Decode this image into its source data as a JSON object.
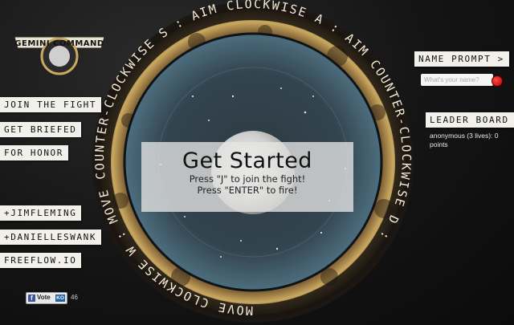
{
  "logo": {
    "text": "GEMINI COMMAND"
  },
  "left_menu": {
    "join": "JOIN THE FIGHT",
    "brief": "GET BRIEFED",
    "honor": "FOR HONOR"
  },
  "credits": {
    "jim": "+JIMFLEMING",
    "danielle": "+DANIELLESWANK",
    "freeflow": "FREEFLOW.IO"
  },
  "ring_text": {
    "top": "AIM CLOCKWISE",
    "key_top": "A",
    "right": "AIM COUNTER-CLOCKWISE",
    "key_right": "D",
    "bottom": "MOVE CLOCKWISE",
    "key_bottom": "W",
    "left": "MOVE COUNTER-CLOCKWISE",
    "key_left": "S",
    "separator": ":"
  },
  "banner": {
    "title": "Get Started",
    "line1": "Press \"J\" to join the fight!",
    "line2": "Press \"ENTER\" to fire!"
  },
  "name_prompt": {
    "label": "NAME PROMPT >",
    "placeholder": "What's your name?",
    "record_icon": "record-icon"
  },
  "leaderboard": {
    "title": "LEADER BOARD",
    "entries": [
      "anonymous (3 lives): 0 points"
    ]
  },
  "vote": {
    "label": "Vote",
    "badge": "KO",
    "count": "46"
  },
  "colors": {
    "ring_outer": "#2a2218",
    "ring_gold": "#c9a860",
    "rust": "#7a5a30",
    "arena": "#3d5a6b",
    "arena_inner": "#2f3f4a",
    "tape": "#f1f0ea",
    "record": "#d40000"
  }
}
